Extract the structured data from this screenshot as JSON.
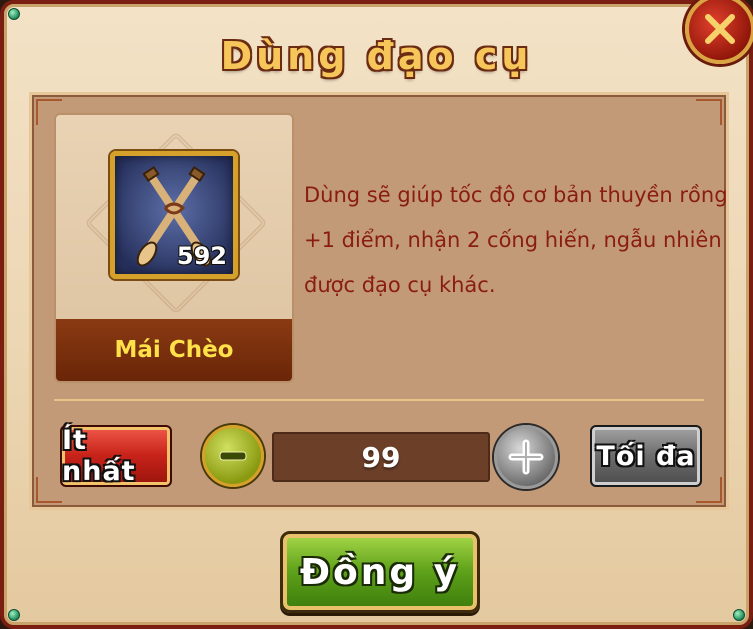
{
  "dialog": {
    "title": "Dùng đạo cụ"
  },
  "item": {
    "icon": "crossed-oars-icon",
    "name": "Mái Chèo",
    "count": "592"
  },
  "description": "Dùng sẽ giúp tốc độ cơ bản thuyền rồng +1 điểm, nhận 2 cống hiến, ngẫu nhiên được đạo cụ khác.",
  "quantity": {
    "min_label": "Ít nhất",
    "value": "99",
    "max_label": "Tối đa",
    "decrease_icon": "minus-icon",
    "increase_icon": "plus-icon"
  },
  "confirm_label": "Đồng ý",
  "colors": {
    "title": "#f7c65a",
    "description": "#8a1c10",
    "item_name": "#ffe14a",
    "confirm": "#5fa21a",
    "min_button": "#c8231a",
    "max_button": "#6e6e6e"
  }
}
